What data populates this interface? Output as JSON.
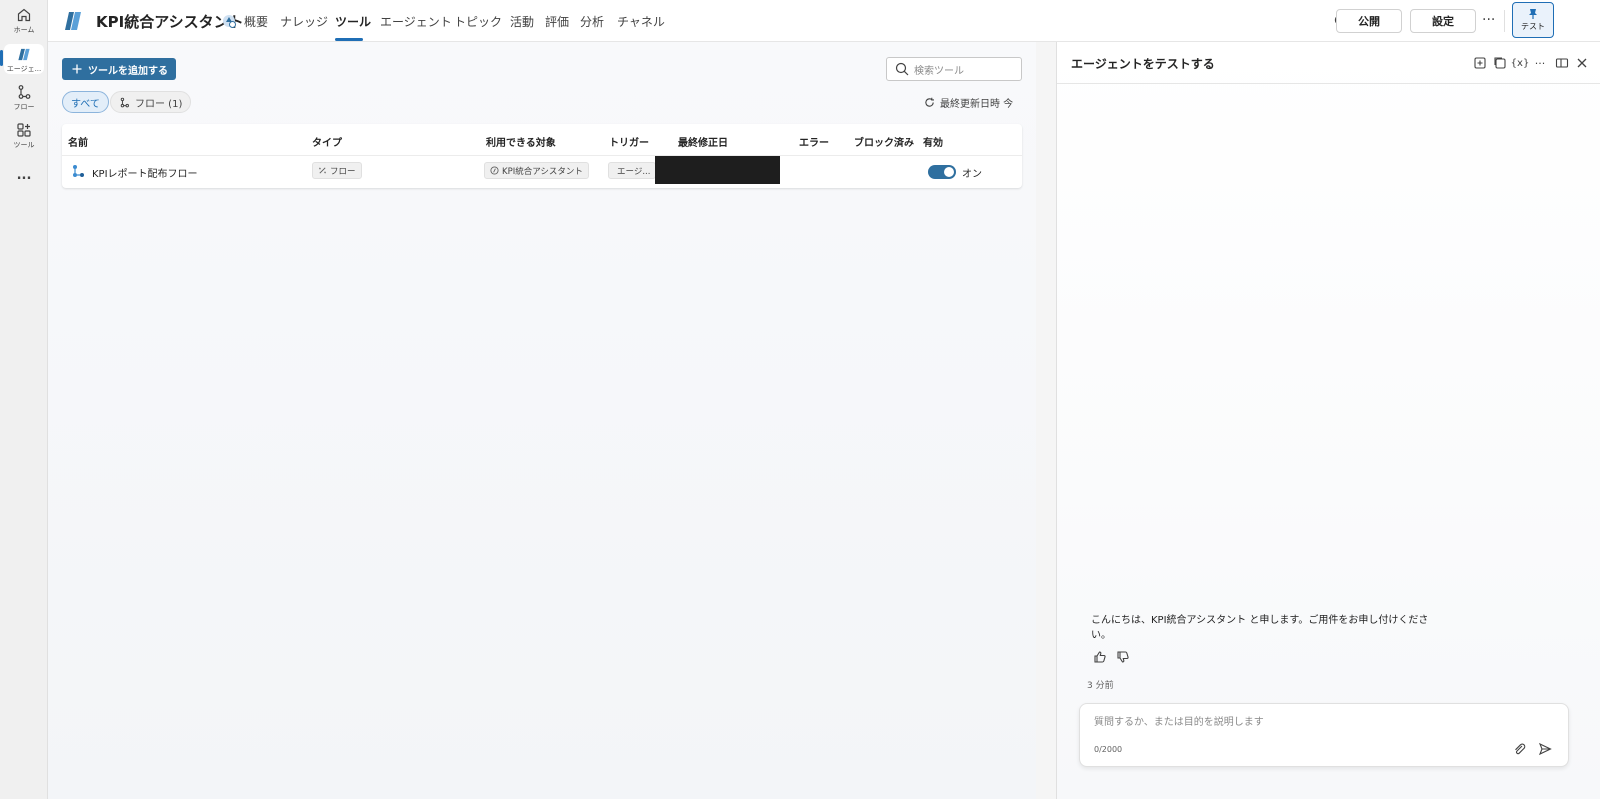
{
  "rail": {
    "items": [
      {
        "label": "ホーム",
        "icon": "home-icon"
      },
      {
        "label": "エージェ...",
        "icon": "agent-icon"
      },
      {
        "label": "フロー",
        "icon": "flow-icon"
      },
      {
        "label": "ツール",
        "icon": "tools-icon"
      },
      {
        "label": "...",
        "icon": "more-icon"
      }
    ]
  },
  "header": {
    "title": "KPI統合アシスタント",
    "tabs": [
      "概要",
      "ナレッジ",
      "ツール",
      "エージェント",
      "トピック",
      "活動",
      "評価",
      "分析",
      "チャネル"
    ],
    "active_tab": "ツール",
    "publish_label": "公開",
    "settings_label": "設定",
    "more_label": "···",
    "test_label": "テスト"
  },
  "tools": {
    "add_button": "ツールを追加する",
    "search_placeholder": "検索ツール",
    "filters": {
      "all": "すべて",
      "flow": "フロー (1)"
    },
    "refresh_label": "最終更新日時 今",
    "columns": [
      "名前",
      "タイプ",
      "利用できる対象",
      "トリガー",
      "最終修正日",
      "エラー",
      "ブロック済み",
      "有効"
    ],
    "rows": [
      {
        "name": "KPIレポート配布フロー",
        "type": "フロー",
        "available_to": "KPI統合アシスタント",
        "trigger": "エージ...",
        "modified": "",
        "errors": "",
        "blocked": "",
        "enabled_label": "オン"
      }
    ]
  },
  "test_panel": {
    "title": "エージェントをテストする",
    "message": "こんにちは、KPI統合アシスタント と申します。ご用件をお申し付けください。",
    "timestamp": "3 分前",
    "input_placeholder": "質問するか、または目的を説明します",
    "char_count": "0/2000"
  },
  "colors": {
    "accent": "#1f6eb5",
    "primary_button": "#2f6f9f"
  }
}
